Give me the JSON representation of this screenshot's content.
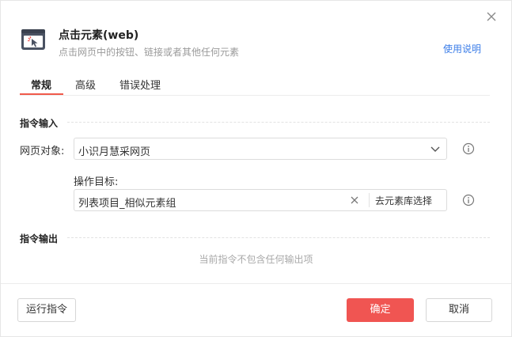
{
  "dialog": {
    "title": "点击元素(web)",
    "subtitle": "点击网页中的按钮、链接或者其他任何元素",
    "help_link": "使用说明"
  },
  "tabs": [
    {
      "label": "常规",
      "active": true
    },
    {
      "label": "高级",
      "active": false
    },
    {
      "label": "错误处理",
      "active": false
    }
  ],
  "input_section": {
    "title": "指令输入",
    "webpage_label": "网页对象:",
    "webpage_value": "小识月慧采网页",
    "target_label": "操作目标:",
    "target_value": "列表项目_相似元素组",
    "pick_button": "去元素库选择"
  },
  "output_section": {
    "title": "指令输出",
    "empty_note": "当前指令不包含任何输出项"
  },
  "footer": {
    "run_button": "运行指令",
    "ok_button": "确定",
    "cancel_button": "取消"
  },
  "colors": {
    "accent": "#f05552",
    "link": "#3b7de8"
  },
  "icons": [
    "close-icon",
    "click-element-icon",
    "chevron-down-icon",
    "info-icon",
    "clear-icon"
  ]
}
